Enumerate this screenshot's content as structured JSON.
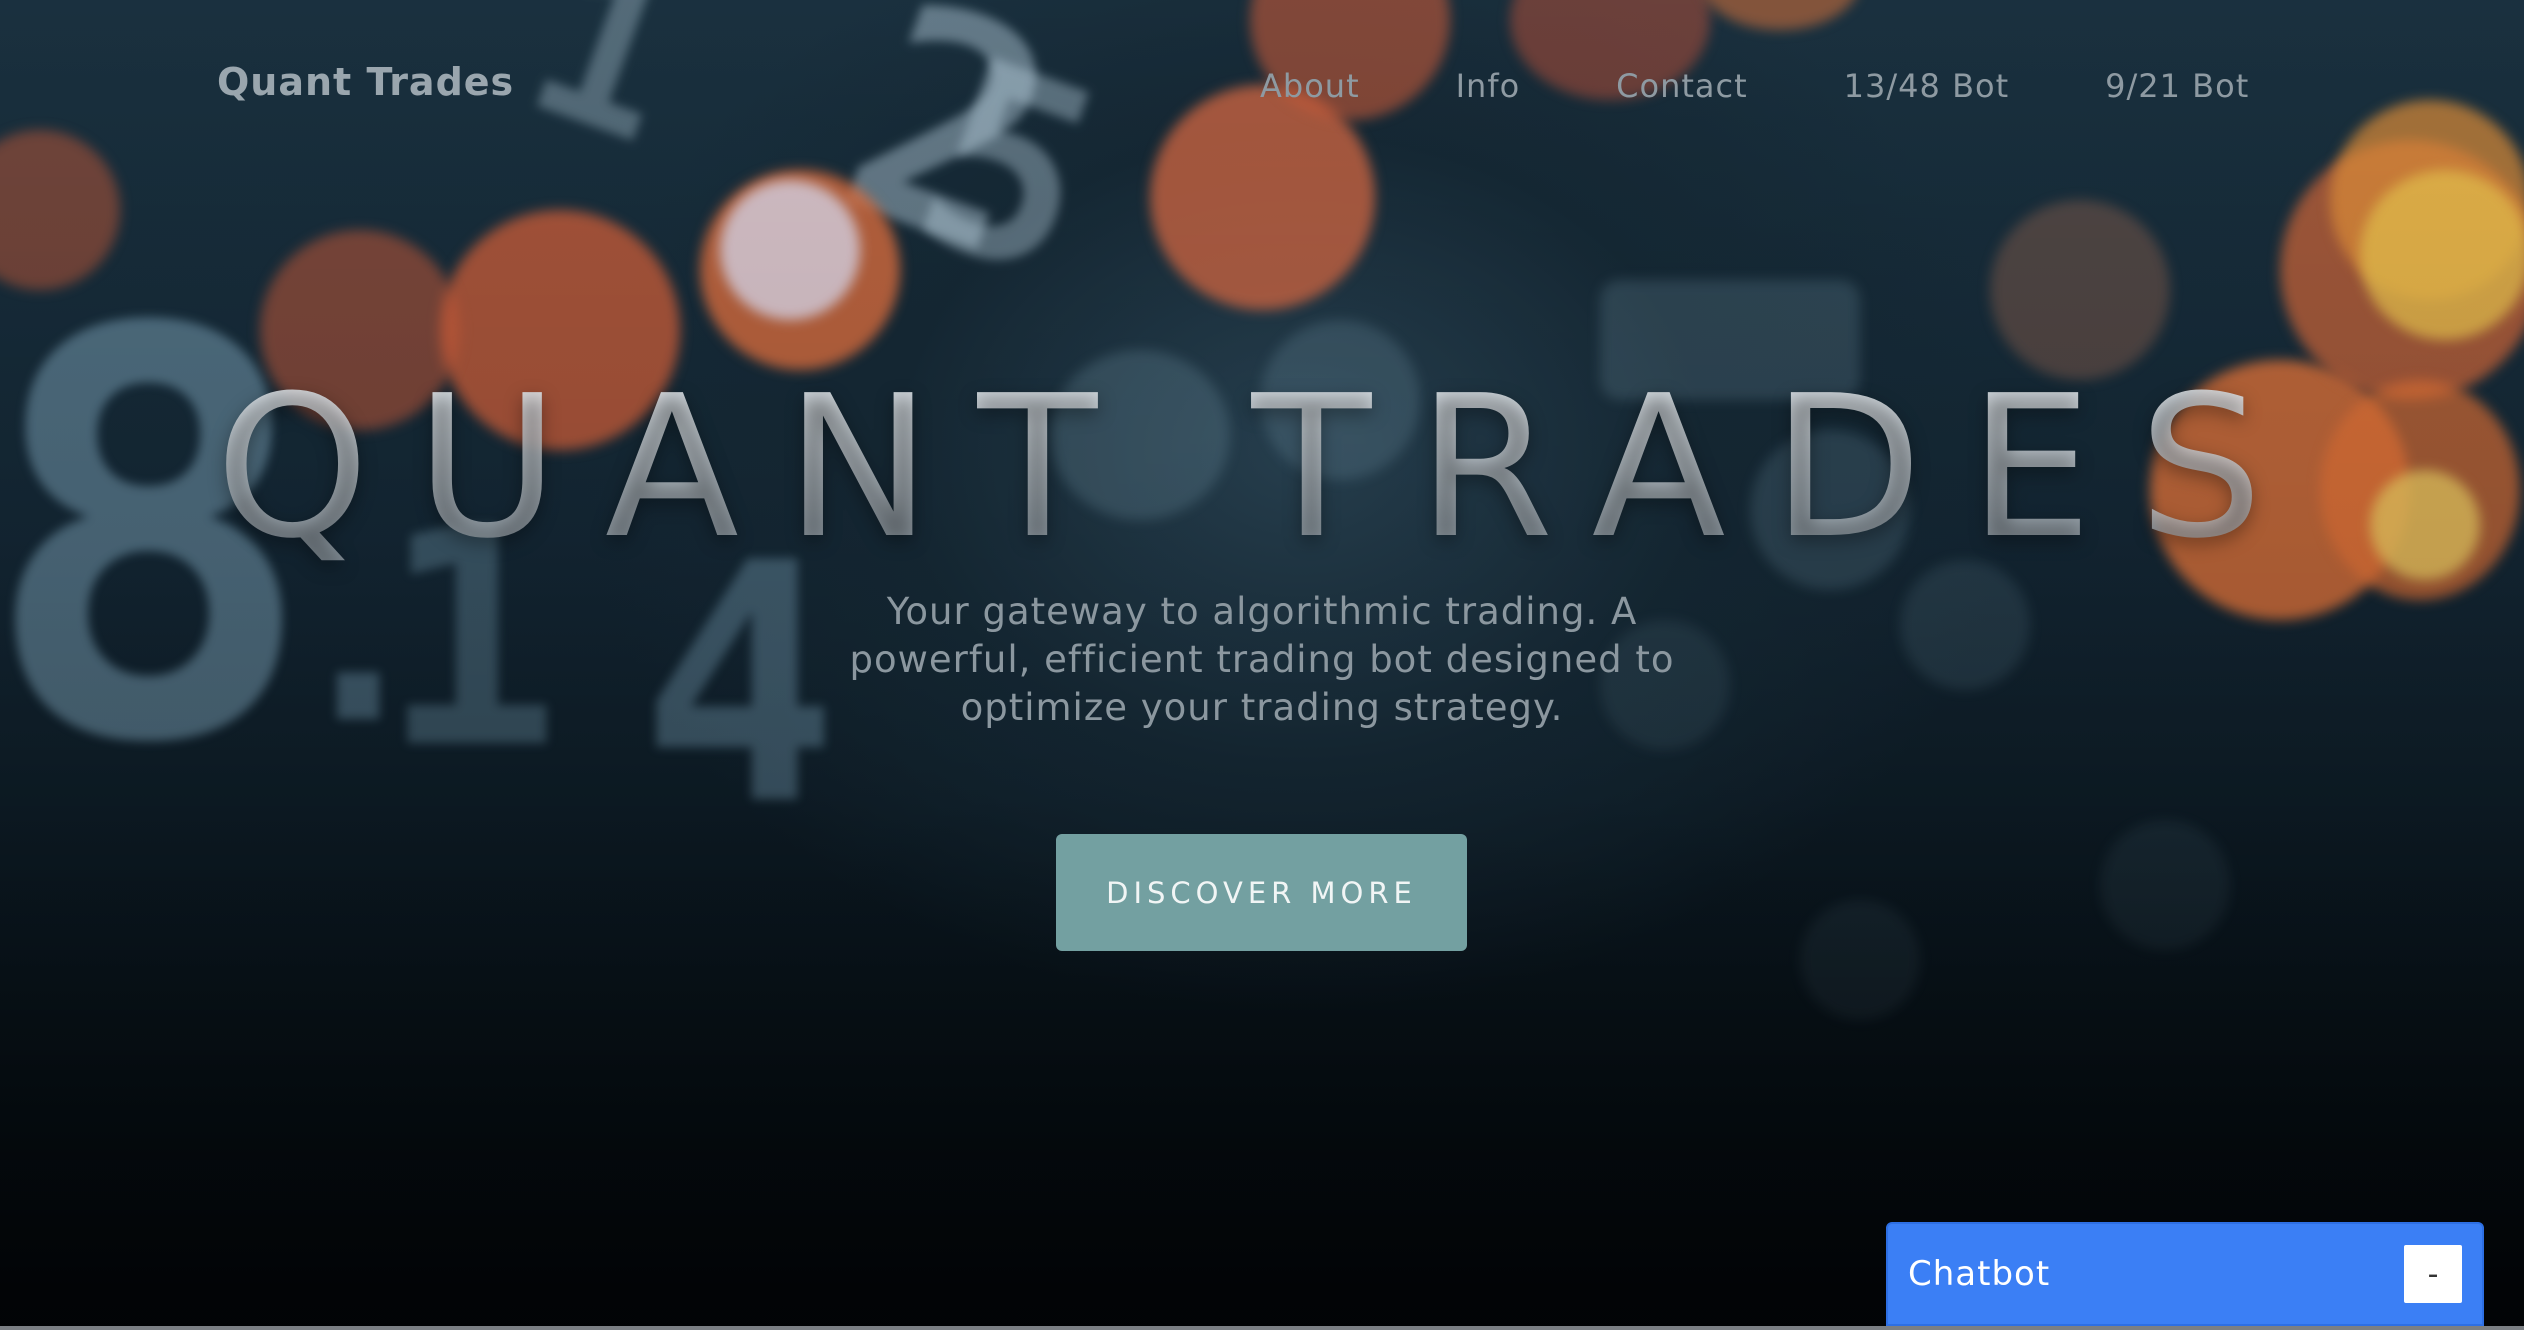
{
  "header": {
    "brand": "Quant Trades",
    "nav": [
      {
        "label": "About"
      },
      {
        "label": "Info"
      },
      {
        "label": "Contact"
      },
      {
        "label": "13/48 Bot"
      },
      {
        "label": "9/21 Bot"
      }
    ]
  },
  "hero": {
    "title": "QUANT TRADES",
    "tagline": "Your gateway to algorithmic trading. A powerful, efficient trading bot designed to optimize your trading strategy.",
    "cta_label": "DISCOVER MORE",
    "background_icon": "stock-ticker-bokeh-image"
  },
  "chatbot": {
    "title": "Chatbot",
    "toggle_label": "-"
  },
  "colors": {
    "cta": "#73a0a1",
    "chatbot": "#3b7ff5"
  }
}
